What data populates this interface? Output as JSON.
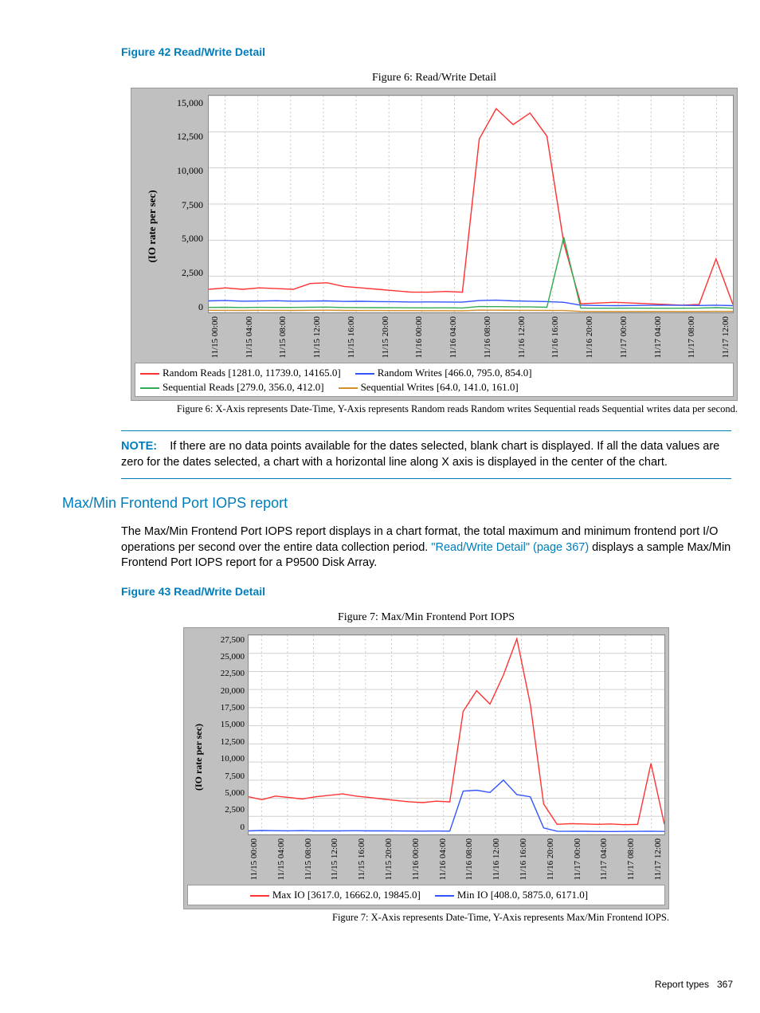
{
  "figure42": {
    "caption": "Figure 42 Read/Write Detail"
  },
  "figure43": {
    "caption": "Figure 43 Read/Write Detail"
  },
  "chart_data": [
    {
      "type": "line",
      "title": "Figure 6: Read/Write Detail",
      "ylabel": "(IO rate per sec)",
      "y_ticks": [
        "0",
        "2,500",
        "5,000",
        "7,500",
        "10,000",
        "12,500",
        "15,000"
      ],
      "ylim": [
        0,
        15000
      ],
      "x_ticks": [
        "11/15 00:00",
        "11/15 04:00",
        "11/15 08:00",
        "11/15 12:00",
        "11/15 16:00",
        "11/15 20:00",
        "11/16 00:00",
        "11/16 04:00",
        "11/16 08:00",
        "11/16 12:00",
        "11/16 16:00",
        "11/16 20:00",
        "11/17 00:00",
        "11/17 04:00",
        "11/17 08:00",
        "11/17 12:00"
      ],
      "series": [
        {
          "name": "Random Reads  [1281.0, 11739.0, 14165.0]",
          "color": "#ff3333",
          "values": [
            1600,
            1700,
            1600,
            1700,
            1650,
            1600,
            2000,
            2050,
            1800,
            1700,
            1600,
            1500,
            1400,
            1400,
            1450,
            1400,
            12000,
            14100,
            13000,
            13800,
            12200,
            4800,
            600,
            650,
            700,
            650,
            600,
            550,
            500,
            550,
            3700,
            550
          ]
        },
        {
          "name": "Random Writes  [466.0, 795.0, 854.0]",
          "color": "#3355ff",
          "values": [
            800,
            820,
            780,
            790,
            810,
            780,
            790,
            800,
            760,
            770,
            750,
            740,
            720,
            730,
            720,
            710,
            820,
            850,
            800,
            780,
            750,
            700,
            500,
            480,
            470,
            480,
            490,
            500,
            490,
            480,
            500,
            470
          ]
        },
        {
          "name": "Sequential Reads  [279.0, 356.0, 412.0]",
          "color": "#33aa55",
          "values": [
            350,
            360,
            340,
            355,
            350,
            345,
            360,
            370,
            340,
            335,
            330,
            325,
            320,
            315,
            320,
            310,
            410,
            400,
            390,
            380,
            360,
            5200,
            300,
            290,
            295,
            300,
            290,
            285,
            295,
            300,
            330,
            290
          ]
        },
        {
          "name": "Sequential Writes  [64.0, 141.0, 161.0]",
          "color": "#d28f2a",
          "values": [
            150,
            145,
            140,
            150,
            145,
            140,
            150,
            155,
            140,
            135,
            130,
            128,
            125,
            122,
            120,
            118,
            160,
            155,
            150,
            145,
            140,
            130,
            70,
            68,
            65,
            66,
            70,
            72,
            68,
            70,
            75,
            70
          ]
        }
      ],
      "footnote": "Figure 6: X-Axis represents Date-Time, Y-Axis represents Random reads Random writes Sequential reads Sequential writes data per second."
    },
    {
      "type": "line",
      "title": "Figure 7: Max/Min Frontend Port IOPS",
      "ylabel": "(IO rate per sec)",
      "y_ticks": [
        "0",
        "2,500",
        "5,000",
        "7,500",
        "10,000",
        "12,500",
        "15,000",
        "17,500",
        "20,000",
        "22,500",
        "25,000",
        "27,500"
      ],
      "ylim": [
        0,
        27500
      ],
      "x_ticks": [
        "11/15 00:00",
        "11/15 04:00",
        "11/15 08:00",
        "11/15 12:00",
        "11/15 16:00",
        "11/15 20:00",
        "11/16 00:00",
        "11/16 04:00",
        "11/16 08:00",
        "11/16 12:00",
        "11/16 16:00",
        "11/16 20:00",
        "11/17 00:00",
        "11/17 04:00",
        "11/17 08:00",
        "11/17 12:00"
      ],
      "series": [
        {
          "name": "Max IO  [3617.0, 16662.0, 19845.0]",
          "color": "#ff3333",
          "values": [
            5200,
            4800,
            5300,
            5100,
            4900,
            5200,
            5400,
            5600,
            5300,
            5100,
            4900,
            4700,
            4500,
            4400,
            4600,
            4500,
            17000,
            19845,
            18000,
            22000,
            27000,
            18000,
            4200,
            1400,
            1500,
            1450,
            1400,
            1450,
            1350,
            1400,
            9800,
            1400
          ]
        },
        {
          "name": "Min IO  [408.0, 5875.0, 6171.0]",
          "color": "#3355ff",
          "values": [
            500,
            550,
            520,
            510,
            530,
            500,
            490,
            510,
            520,
            500,
            490,
            480,
            470,
            460,
            470,
            460,
            6000,
            6100,
            5800,
            7500,
            5500,
            5200,
            900,
            450,
            430,
            440,
            420,
            410,
            420,
            430,
            450,
            420
          ]
        }
      ],
      "footnote": "Figure 7: X-Axis represents Date-Time, Y-Axis represents Max/Min Frontend IOPS."
    }
  ],
  "note": {
    "label": "NOTE:",
    "body": "If there are no data points available for the dates selected, blank chart is displayed. If all the data values are zero for the dates selected, a chart with a horizontal line along X axis is displayed in the center of the chart."
  },
  "section": {
    "heading": "Max/Min Frontend Port IOPS report",
    "body_before": "The Max/Min Frontend Port IOPS report displays in a chart format, the total maximum and minimum frontend port I/O operations per second over the entire data collection period. ",
    "link_text": "\"Read/Write Detail\" (page 367)",
    "body_after": " displays a sample Max/Min Frontend Port IOPS report for a P9500 Disk Array."
  },
  "footer": {
    "label": "Report types",
    "page": "367"
  }
}
